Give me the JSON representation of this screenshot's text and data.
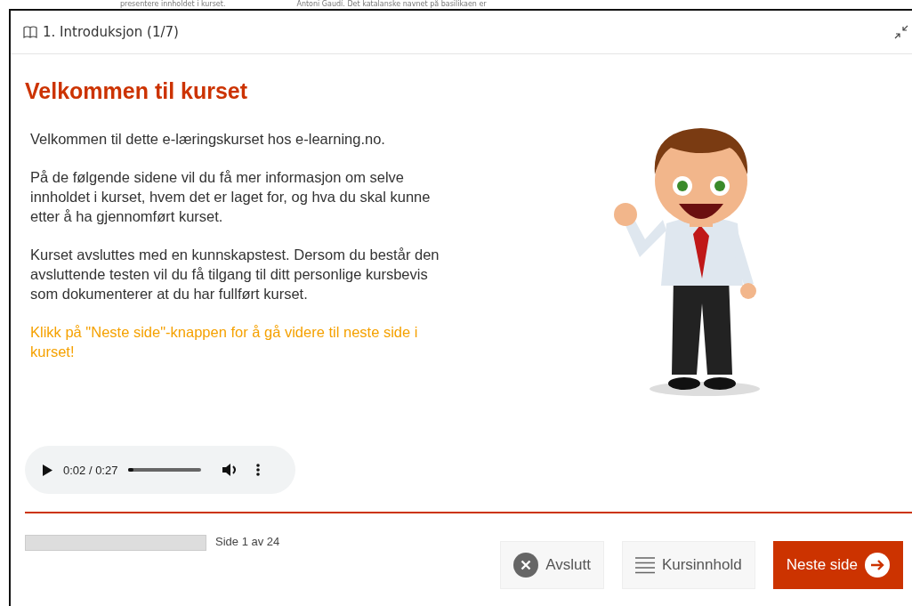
{
  "backdrop": {
    "texts": [
      "presentere innholdet i kurset.",
      "Antoni Gaudí. Det katalanske navnet på basilikaen er"
    ]
  },
  "window": {
    "title": "1. Introduksjon (1/7)"
  },
  "heading": "Velkommen til kurset",
  "paragraphs": [
    {
      "kind": "normal",
      "text": "Velkommen til dette e-læringskurset hos e-learning.no."
    },
    {
      "kind": "normal",
      "text": "På de følgende sidene vil du få mer informasjon om selve innholdet i kurset, hvem det er laget for, og hva du skal kunne etter å ha gjennomført kurset."
    },
    {
      "kind": "normal",
      "text": "Kurset avsluttes med en kunnskapstest. Dersom du består den avsluttende testen vil du få tilgang til ditt personlige kursbevis som dokumenterer at du har fullført kurset."
    },
    {
      "kind": "highlight",
      "text": "Klikk på \"Neste side\"-knappen for å gå videre til neste side i kurset!"
    }
  ],
  "audio": {
    "time": "0:02 / 0:27",
    "level": 0.07
  },
  "progress": {
    "level": 0,
    "label": "Side 1 av 24"
  },
  "buttons": [
    {
      "kind": "exit",
      "label": "Avslutt"
    },
    {
      "kind": "contents",
      "label": "Kursinnhold"
    },
    {
      "kind": "next",
      "label": "Neste side"
    }
  ]
}
